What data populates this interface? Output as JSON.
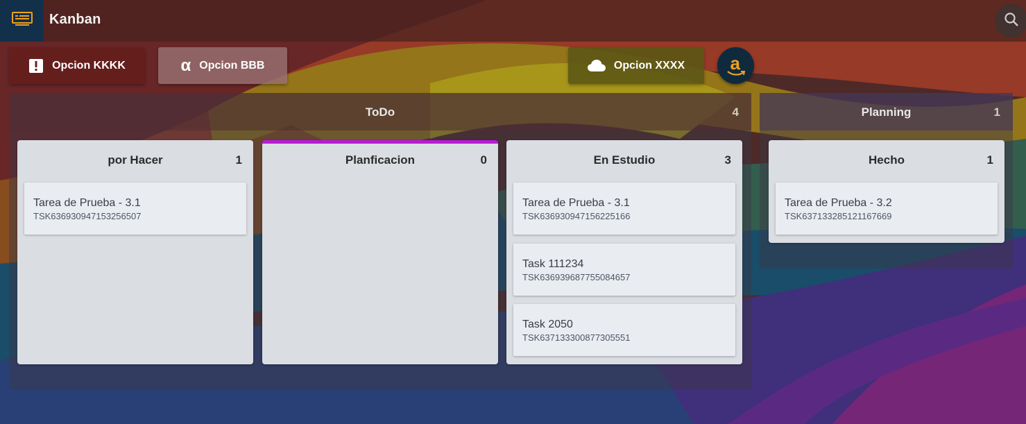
{
  "app": {
    "title": "Kanban",
    "icon": "keyboard-icon"
  },
  "toolbar": {
    "buttons": [
      {
        "label": "Opcion KKKK",
        "icon": "exclamation-icon"
      },
      {
        "label": "Opcion BBB",
        "icon": "alpha-icon",
        "glyph": "α"
      },
      {
        "label": "Opcion XXXX",
        "icon": "cloud-icon"
      }
    ],
    "amazon_glyph": "a"
  },
  "groups": [
    {
      "title": "ToDo",
      "count": "4",
      "columns": [
        {
          "title": "por Hacer",
          "count": "1",
          "cards": [
            {
              "title": "Tarea de Prueba - 3.1",
              "id": "TSK636930947153256507"
            }
          ]
        },
        {
          "title": "Planficacion",
          "count": "0",
          "accent": "#b81bd6",
          "cards": []
        },
        {
          "title": "En Estudio",
          "count": "3",
          "cards": [
            {
              "title": "Tarea de Prueba - 3.1",
              "id": "TSK636930947156225166"
            },
            {
              "title": "Task 111234",
              "id": "TSK636939687755084657"
            },
            {
              "title": "Task 2050",
              "id": "TSK637133300877305551"
            }
          ]
        }
      ]
    },
    {
      "title": "Planning",
      "count": "1",
      "columns": [
        {
          "title": "Hecho",
          "count": "1",
          "cards": [
            {
              "title": "Tarea de Prueba - 3.2",
              "id": "TSK637133285121167669"
            }
          ]
        }
      ]
    }
  ],
  "colors": {
    "accent": "#b81bd6",
    "appbar_icon_bg": "#12304a",
    "icon_orange": "#f0a020"
  }
}
